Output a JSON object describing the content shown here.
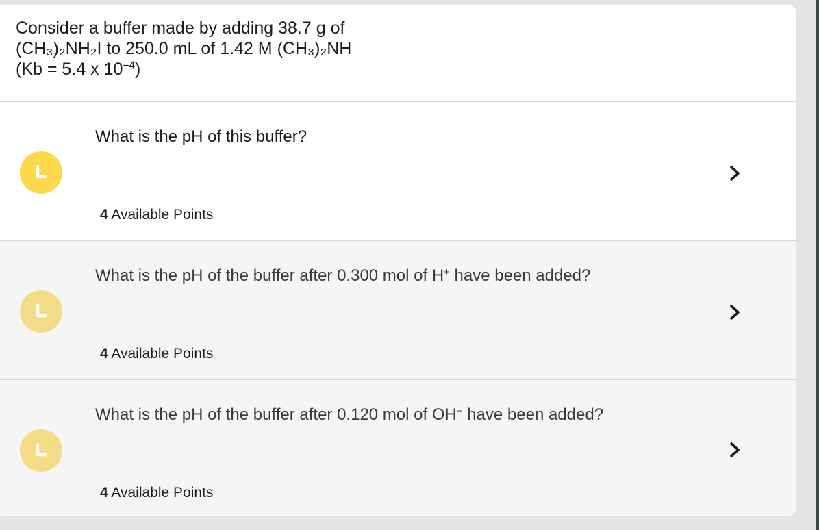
{
  "prompt": {
    "line1": "Consider a buffer made by adding 38.7 g of",
    "line2": "(CH₃)₂NH₂I to 250.0 mL of 1.42 M (CH₃)₂NH",
    "line3_prefix": "(Kb = 5.4 x 10",
    "line3_exp": "−4",
    "line3_suffix": ")"
  },
  "questions": [
    {
      "text_prefix": "What is the pH of this buffer?",
      "text_sup": "",
      "text_suffix": "",
      "points_num": "4",
      "points_label": "Available Points",
      "status_icon": "timer-icon",
      "state": "active"
    },
    {
      "text_prefix": "What is the pH of the buffer after 0.300 mol of H",
      "text_sup": "+",
      "text_suffix": " have been added?",
      "points_num": "4",
      "points_label": "Available Points",
      "status_icon": "timer-icon",
      "state": "inactive"
    },
    {
      "text_prefix": "What is the pH of the buffer after 0.120 mol of OH",
      "text_sup": "−",
      "text_suffix": " have been added?",
      "points_num": "4",
      "points_label": "Available Points",
      "status_icon": "timer-icon",
      "state": "inactive"
    }
  ],
  "colors": {
    "icon_active": "#fcd94a",
    "icon_inactive": "#f2dc86",
    "chevron": "#1c1c1e",
    "row_inactive_bg": "#f5f5f5"
  }
}
